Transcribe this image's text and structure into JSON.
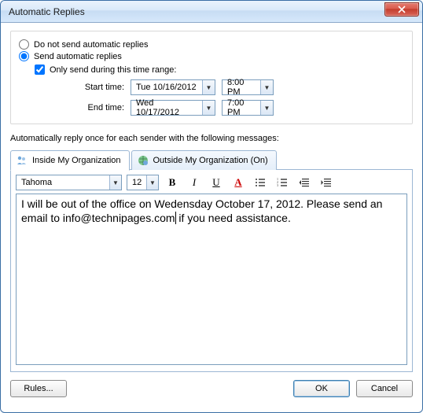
{
  "window": {
    "title": "Automatic Replies"
  },
  "radios": {
    "do_not_send": "Do not send automatic replies",
    "send": "Send automatic replies",
    "selected": "send"
  },
  "range": {
    "checkbox_label": "Only send during this time range:",
    "checked": true,
    "start_label": "Start time:",
    "start_date": "Tue 10/16/2012",
    "start_time": "8:00 PM",
    "end_label": "End time:",
    "end_date": "Wed 10/17/2012",
    "end_time": "7:00 PM"
  },
  "section_label": "Automatically reply once for each sender with the following messages:",
  "tabs": {
    "inside": "Inside My Organization",
    "outside": "Outside My Organization (On)",
    "active": "inside"
  },
  "format": {
    "font": "Tahoma",
    "size": "12"
  },
  "message": {
    "before_cursor": "I will be out of the office on Wedensday October 17, 2012. Please send an email to info@technipages.com",
    "after_cursor": " if you need assistance."
  },
  "buttons": {
    "rules": "Rules...",
    "ok": "OK",
    "cancel": "Cancel"
  }
}
